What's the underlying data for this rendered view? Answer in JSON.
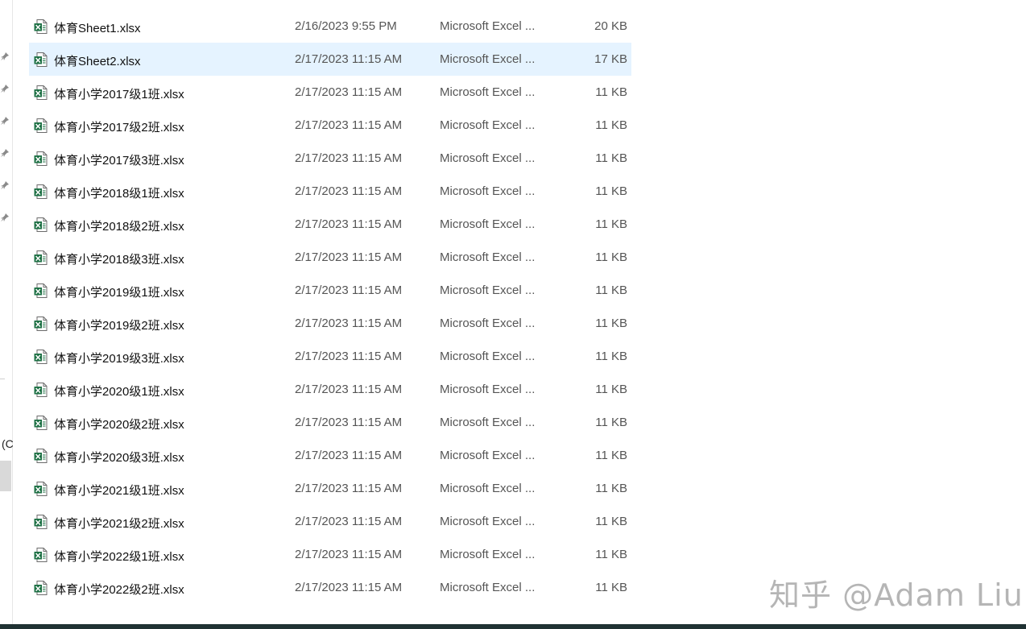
{
  "sidebar": {
    "fragment_text": "(C",
    "pins": [
      "pin-icon",
      "pin-icon",
      "pin-icon",
      "pin-icon",
      "pin-icon",
      "pin-icon"
    ]
  },
  "files": [
    {
      "name": "体育Sheet1.xlsx",
      "date": "2/16/2023 9:55 PM",
      "type": "Microsoft Excel ...",
      "size": "20 KB"
    },
    {
      "name": "体育Sheet2.xlsx",
      "date": "2/17/2023 11:15 AM",
      "type": "Microsoft Excel ...",
      "size": "17 KB"
    },
    {
      "name": "体育小学2017级1班.xlsx",
      "date": "2/17/2023 11:15 AM",
      "type": "Microsoft Excel ...",
      "size": "11 KB"
    },
    {
      "name": "体育小学2017级2班.xlsx",
      "date": "2/17/2023 11:15 AM",
      "type": "Microsoft Excel ...",
      "size": "11 KB"
    },
    {
      "name": "体育小学2017级3班.xlsx",
      "date": "2/17/2023 11:15 AM",
      "type": "Microsoft Excel ...",
      "size": "11 KB"
    },
    {
      "name": "体育小学2018级1班.xlsx",
      "date": "2/17/2023 11:15 AM",
      "type": "Microsoft Excel ...",
      "size": "11 KB"
    },
    {
      "name": "体育小学2018级2班.xlsx",
      "date": "2/17/2023 11:15 AM",
      "type": "Microsoft Excel ...",
      "size": "11 KB"
    },
    {
      "name": "体育小学2018级3班.xlsx",
      "date": "2/17/2023 11:15 AM",
      "type": "Microsoft Excel ...",
      "size": "11 KB"
    },
    {
      "name": "体育小学2019级1班.xlsx",
      "date": "2/17/2023 11:15 AM",
      "type": "Microsoft Excel ...",
      "size": "11 KB"
    },
    {
      "name": "体育小学2019级2班.xlsx",
      "date": "2/17/2023 11:15 AM",
      "type": "Microsoft Excel ...",
      "size": "11 KB"
    },
    {
      "name": "体育小学2019级3班.xlsx",
      "date": "2/17/2023 11:15 AM",
      "type": "Microsoft Excel ...",
      "size": "11 KB"
    },
    {
      "name": "体育小学2020级1班.xlsx",
      "date": "2/17/2023 11:15 AM",
      "type": "Microsoft Excel ...",
      "size": "11 KB"
    },
    {
      "name": "体育小学2020级2班.xlsx",
      "date": "2/17/2023 11:15 AM",
      "type": "Microsoft Excel ...",
      "size": "11 KB"
    },
    {
      "name": "体育小学2020级3班.xlsx",
      "date": "2/17/2023 11:15 AM",
      "type": "Microsoft Excel ...",
      "size": "11 KB"
    },
    {
      "name": "体育小学2021级1班.xlsx",
      "date": "2/17/2023 11:15 AM",
      "type": "Microsoft Excel ...",
      "size": "11 KB"
    },
    {
      "name": "体育小学2021级2班.xlsx",
      "date": "2/17/2023 11:15 AM",
      "type": "Microsoft Excel ...",
      "size": "11 KB"
    },
    {
      "name": "体育小学2022级1班.xlsx",
      "date": "2/17/2023 11:15 AM",
      "type": "Microsoft Excel ...",
      "size": "11 KB"
    },
    {
      "name": "体育小学2022级2班.xlsx",
      "date": "2/17/2023 11:15 AM",
      "type": "Microsoft Excel ...",
      "size": "11 KB"
    }
  ],
  "selected_index": 1,
  "file_icon": "excel-file-icon",
  "colors": {
    "selection": "#e5f3ff",
    "excel_green": "#1d7044",
    "taskbar": "#203233"
  },
  "watermark": "知乎 @Adam Liu"
}
